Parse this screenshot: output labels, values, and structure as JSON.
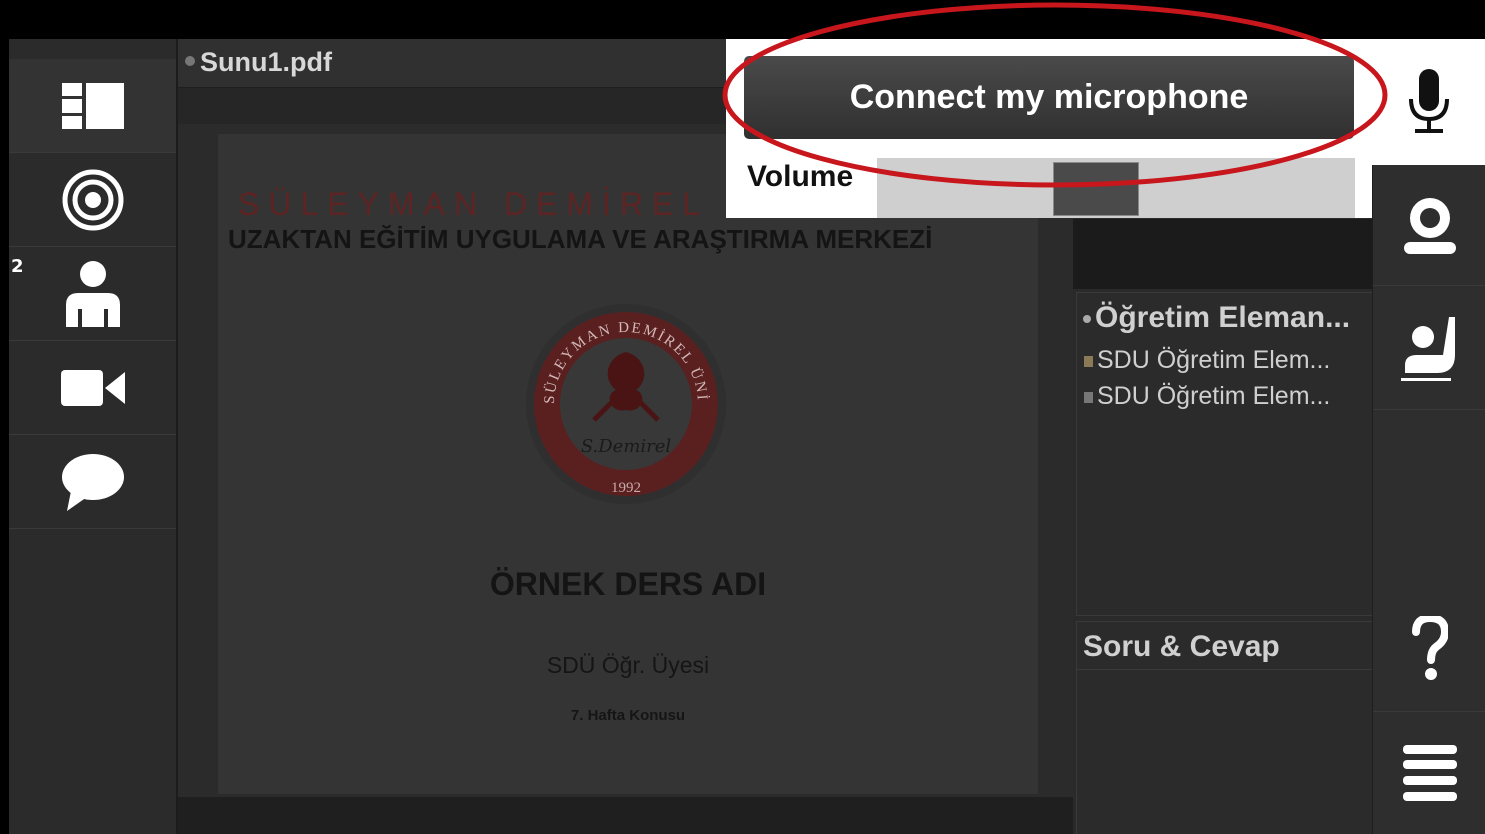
{
  "presentation": {
    "filename": "Sunu1.pdf",
    "slide": {
      "line1": "SÜLEYMAN DEMİREL Ü",
      "line2": "UZAKTAN EĞİTİM UYGULAMA VE ARAŞTIRMA MERKEZİ",
      "course_title": "ÖRNEK DERS ADI",
      "lecturer": "SDÜ Öğr. Üyesi",
      "topic": "7. Hafta Konusu",
      "seal": {
        "ring_text": "SÜLEYMAN DEMİREL ÜNİVERSİTESİ",
        "signature": "S.Demirel",
        "year": "1992"
      }
    }
  },
  "left_sidebar": {
    "participant_count": "2",
    "items": [
      "layout-icon",
      "broadcast-icon",
      "user-icon",
      "video-camera-icon",
      "chat-bubble-icon"
    ]
  },
  "users_panel": {
    "header": "Öğretim Eleman...",
    "rows": [
      "SDU Öğretim Elem...",
      "SDU Öğretim Elem..."
    ]
  },
  "qa_panel": {
    "header": "Soru & Cevap"
  },
  "audio_popup": {
    "connect_label": "Connect my microphone",
    "volume_label": "Volume",
    "volume_level": 0.45
  },
  "right_sidebar": {
    "items": [
      "microphone-icon",
      "webcam-icon",
      "raise-hand-icon",
      "help-icon",
      "menu-icon"
    ]
  },
  "colors": {
    "highlight_oval": "#c8161d",
    "popup_bg": "#ffffff",
    "button_bg": "#3a3a3a"
  }
}
